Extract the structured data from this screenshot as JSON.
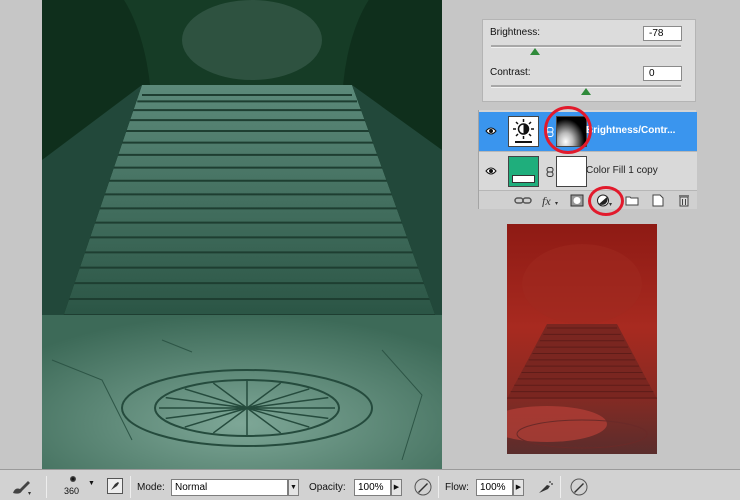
{
  "adjustments": {
    "brightness_label": "Brightness:",
    "brightness_value": "-78",
    "brightness_level": 0.23,
    "contrast_label": "Contrast:",
    "contrast_value": "0",
    "contrast_level": 0.5
  },
  "layers": [
    {
      "name": "Brightness/Contr...",
      "selected": true,
      "thumb_icon": "brightness-contrast-icon",
      "mask": "black-white-gradient-mask"
    },
    {
      "name": "Color Fill 1 copy",
      "selected": false,
      "thumb_color": "#1fae7c",
      "mask": "white-mask"
    }
  ],
  "layers_toolbar_icons": [
    "link-layers-icon",
    "fx-icon",
    "layer-mask-icon",
    "adjustment-layer-icon",
    "new-group-icon",
    "new-layer-icon",
    "trash-icon"
  ],
  "options_bar": {
    "brush_size": "360",
    "mode_label": "Mode:",
    "mode_value": "Normal",
    "opacity_label": "Opacity:",
    "opacity_value": "100%",
    "flow_label": "Flow:",
    "flow_value": "100%"
  },
  "colors": {
    "highlight": "#e21a2c",
    "selected_layer": "#3a95ee",
    "canvas_tint": "#1f4a34",
    "preview_tint": "#a02820"
  }
}
